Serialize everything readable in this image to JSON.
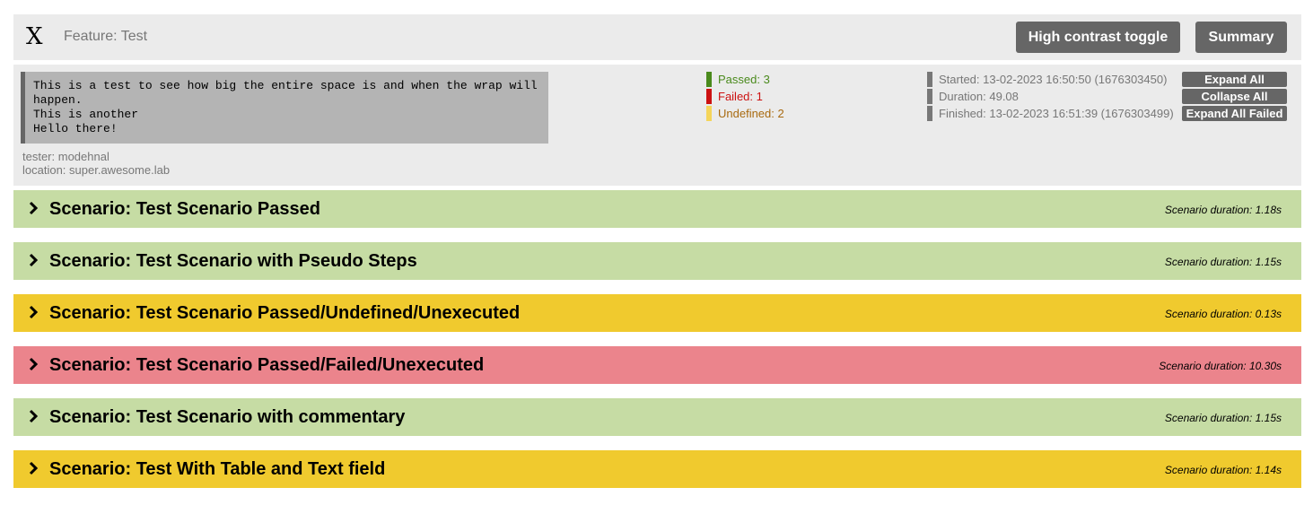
{
  "header": {
    "logo_glyph": "X",
    "feature_title": "Feature: Test",
    "contrast_button": "High contrast toggle",
    "summary_button": "Summary"
  },
  "description": {
    "lines": "This is a test to see how big the entire space is and when the wrap will happen.\nThis is another\nHello there!"
  },
  "tags": {
    "tester": "tester: modehnal",
    "location": "location: super.awesome.lab"
  },
  "counts": {
    "passed": "Passed: 3",
    "failed": "Failed: 1",
    "undefined": "Undefined: 2"
  },
  "timing": {
    "started": "Started: 13-02-2023 16:50:50 (1676303450)",
    "duration": "Duration: 49.08",
    "finished": "Finished: 13-02-2023 16:51:39 (1676303499)"
  },
  "actions": {
    "expand_all": "Expand All",
    "collapse_all": "Collapse All",
    "expand_all_failed": "Expand All Failed"
  },
  "colors": {
    "passed": "#c6dca4",
    "undefined": "#f0ca2e",
    "failed": "#eb848c"
  },
  "scenarios": [
    {
      "name": "Scenario: Test Scenario Passed",
      "duration": "Scenario duration: 1.18s",
      "status": "passed"
    },
    {
      "name": "Scenario: Test Scenario with Pseudo Steps",
      "duration": "Scenario duration: 1.15s",
      "status": "passed"
    },
    {
      "name": "Scenario: Test Scenario Passed/Undefined/Unexecuted",
      "duration": "Scenario duration: 0.13s",
      "status": "undefined"
    },
    {
      "name": "Scenario: Test Scenario Passed/Failed/Unexecuted",
      "duration": "Scenario duration: 10.30s",
      "status": "failed"
    },
    {
      "name": "Scenario: Test Scenario with commentary",
      "duration": "Scenario duration: 1.15s",
      "status": "passed"
    },
    {
      "name": "Scenario: Test With Table and Text field",
      "duration": "Scenario duration: 1.14s",
      "status": "undefined"
    }
  ]
}
